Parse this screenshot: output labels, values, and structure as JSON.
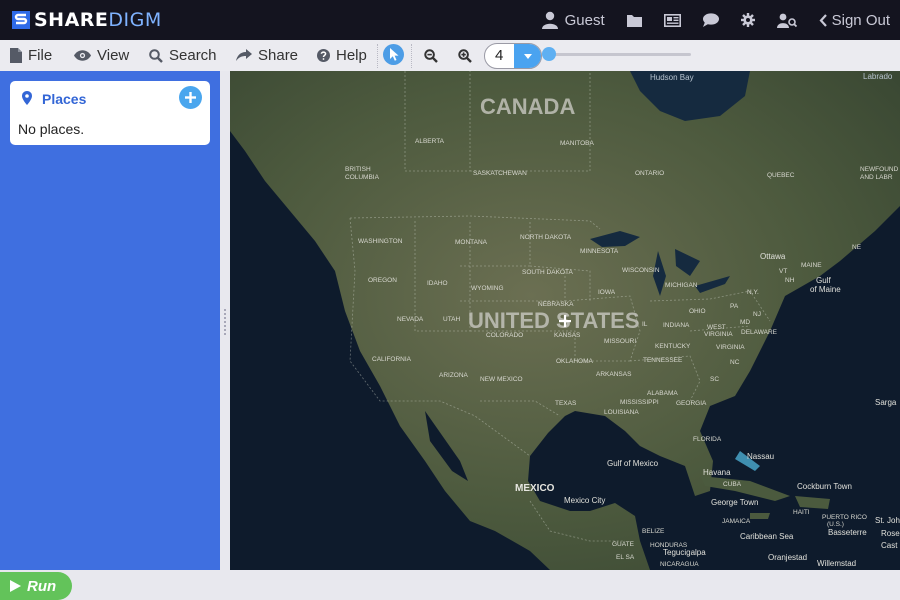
{
  "header": {
    "logo_share": "SHARE",
    "logo_digm": "DIGM",
    "user_label": "Guest",
    "signout_label": "Sign Out",
    "icons": [
      "user-icon",
      "folder-icon",
      "newspaper-icon",
      "chat-icon",
      "gear-icon",
      "user-search-icon",
      "chevron-left-icon"
    ]
  },
  "toolbar": {
    "file_label": "File",
    "view_label": "View",
    "search_label": "Search",
    "share_label": "Share",
    "help_label": "Help",
    "zoom_level": "4",
    "zoom_slider_fraction": 0.0
  },
  "sidebar": {
    "places_title": "Places",
    "places_empty": "No places."
  },
  "map": {
    "labels": {
      "canada": "CANADA",
      "united_states": "UNITED STATES",
      "mexico": "MEXICO",
      "hudson_bay": "Hudson Bay",
      "labrador": "Labrado",
      "alberta": "ALBERTA",
      "manitoba": "MANITOBA",
      "saskatchewan": "SASKATCHEWAN",
      "ontario": "ONTARIO",
      "quebec": "QUEBEC",
      "british_columbia_1": "BRITISH",
      "british_columbia_2": "COLUMBIA",
      "newfoundland_1": "NEWFOUND",
      "newfoundland_2": "AND LABR",
      "washington": "WASHINGTON",
      "montana": "MONTANA",
      "north_dakota": "NORTH DAKOTA",
      "minnesota": "MINNESOTA",
      "south_dakota": "SOUTH DAKOTA",
      "wisconsin": "WISCONSIN",
      "michigan": "MICHIGAN",
      "oregon": "OREGON",
      "idaho": "IDAHO",
      "wyoming": "WYOMING",
      "iowa": "IOWA",
      "nebraska": "NEBRASKA",
      "nevada": "NEVADA",
      "utah": "UTAH",
      "colorado": "COLORADO",
      "kansas": "KANSAS",
      "missouri": "MISSOURI",
      "illinois": "IL",
      "indiana": "INDIANA",
      "ohio": "OHIO",
      "pennsylvania": "PA",
      "new_york": "N.Y.",
      "west_virginia": "WEST",
      "virginia": "VIRGINIA",
      "kentucky": "KENTUCKY",
      "tennessee": "TENNESSEE",
      "nc": "NC",
      "sc": "SC",
      "oklahoma": "OKLAHOMA",
      "arkansas": "ARKANSAS",
      "mississippi": "MISSISSIPPI",
      "alabama": "ALABAMA",
      "georgia": "GEORGIA",
      "louisiana": "LOUISIANA",
      "texas": "TEXAS",
      "new_mexico": "NEW MEXICO",
      "arizona": "ARIZONA",
      "california": "CALIFORNIA",
      "florida": "FLORIDA",
      "maine": "MAINE",
      "vt": "VT",
      "nh": "NH",
      "ottawa": "Ottawa",
      "gulf_of_maine_1": "Gulf",
      "gulf_of_maine_2": "of Maine",
      "md": "MD",
      "delaware": "DELAWARE",
      "nj": "NJ",
      "ne": "NE",
      "gulf_of_mexico": "Gulf of Mexico",
      "sargasso": "Sarga",
      "nassau": "Nassau",
      "havana": "Havana",
      "cuba": "CUBA",
      "cockburn_town": "Cockburn Town",
      "george_town": "George Town",
      "jamaica": "JAMAICA",
      "haiti": "HAITI",
      "puerto_rico": "PUERTO RICO",
      "puerto_rico_us": "(U.S.)",
      "st_john": "St. Joh",
      "mexico_city": "Mexico City",
      "belize": "BELIZE",
      "guatemala": "GUATE",
      "honduras": "HONDURAS",
      "el_salvador": "EL SA",
      "tegucigalpa": "Tegucigalpa",
      "nicaragua": "NICARAGUA",
      "caribbean_sea": "Caribbean Sea",
      "basseterre": "Basseterre",
      "oranjestad": "Oranjestad",
      "willemstad": "Willemstad",
      "roseau": "Rose",
      "castries": "Cast"
    }
  },
  "footer": {
    "run_label": "Run"
  },
  "colors": {
    "accent": "#4aa3f0",
    "sidebar": "#3f6fe0",
    "run": "#63c35a",
    "topbar": "#14141f"
  }
}
